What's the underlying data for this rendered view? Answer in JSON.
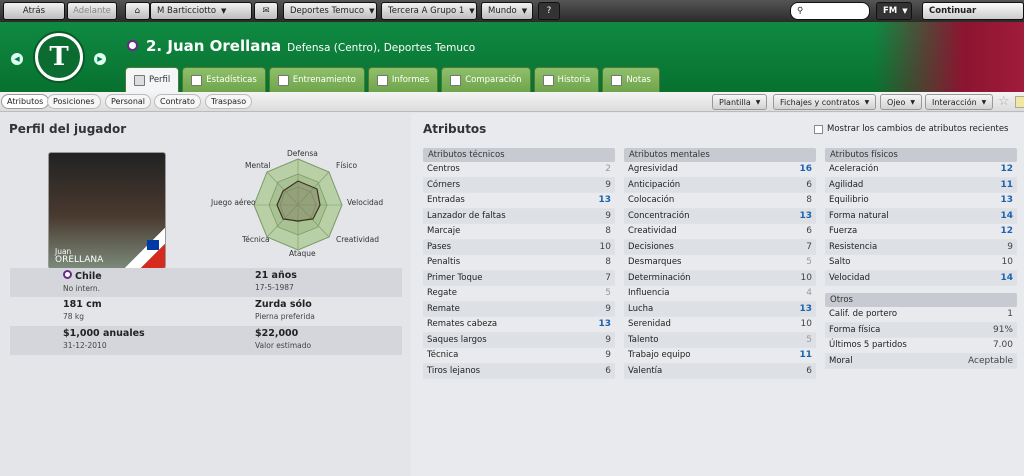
{
  "topbar": {
    "back": "Atrás",
    "forward": "Adelante",
    "manager": "M Barticciotto",
    "club": "Deportes Temuco",
    "league": "Tercera A Grupo 1",
    "world": "Mundo",
    "help": "?",
    "fm": "FM",
    "continue": "Continuar"
  },
  "header": {
    "number_name": "2. Juan Orellana",
    "subtitle": "Defensa (Centro), Deportes Temuco",
    "crest_letter": "T"
  },
  "tabs": [
    "Perfil",
    "Estadísticas",
    "Entrenamiento",
    "Informes",
    "Comparación",
    "Historia",
    "Notas"
  ],
  "subtabs": [
    "Atributos",
    "Posiciones",
    "Personal",
    "Contrato",
    "Traspaso"
  ],
  "actions": [
    "Plantilla",
    "Fichajes y contratos",
    "Ojeo",
    "Interacción"
  ],
  "profile": {
    "title": "Perfil del jugador",
    "photo_first": "Juan",
    "photo_last": "ORELLANA",
    "radar_labels": {
      "top": "Defensa",
      "tr": "Físico",
      "r": "Velocidad",
      "br": "Creatividad",
      "b": "Ataque",
      "bl": "Técnica",
      "l": "Juego aéreo",
      "tl": "Mental"
    },
    "nation": "Chile",
    "intl": "No intern.",
    "age": "21 años",
    "dob": "17-5-1987",
    "height": "181 cm",
    "weight": "78 kg",
    "foot": "Zurda sólo",
    "foot_label": "Pierna preferida",
    "wage": "$1,000 anuales",
    "contract_end": "31-12-2010",
    "value": "$22,000",
    "value_label": "Valor estimado"
  },
  "attributes": {
    "title": "Atributos",
    "checkbox": "Mostrar los cambios de atributos recientes",
    "technical": {
      "title": "Atributos técnicos",
      "rows": [
        [
          "Centros",
          "2"
        ],
        [
          "Córners",
          "9"
        ],
        [
          "Entradas",
          "13"
        ],
        [
          "Lanzador de faltas",
          "9"
        ],
        [
          "Marcaje",
          "8"
        ],
        [
          "Pases",
          "10"
        ],
        [
          "Penaltis",
          "8"
        ],
        [
          "Primer Toque",
          "7"
        ],
        [
          "Regate",
          "5"
        ],
        [
          "Remate",
          "9"
        ],
        [
          "Remates cabeza",
          "13"
        ],
        [
          "Saques largos",
          "9"
        ],
        [
          "Técnica",
          "9"
        ],
        [
          "Tiros lejanos",
          "6"
        ]
      ]
    },
    "mental": {
      "title": "Atributos mentales",
      "rows": [
        [
          "Agresividad",
          "16"
        ],
        [
          "Anticipación",
          "6"
        ],
        [
          "Colocación",
          "8"
        ],
        [
          "Concentración",
          "13"
        ],
        [
          "Creatividad",
          "6"
        ],
        [
          "Decisiones",
          "7"
        ],
        [
          "Desmarques",
          "5"
        ],
        [
          "Determinación",
          "10"
        ],
        [
          "Influencia",
          "4"
        ],
        [
          "Lucha",
          "13"
        ],
        [
          "Serenidad",
          "10"
        ],
        [
          "Talento",
          "5"
        ],
        [
          "Trabajo equipo",
          "11"
        ],
        [
          "Valentía",
          "6"
        ]
      ]
    },
    "physical": {
      "title": "Atributos físicos",
      "rows": [
        [
          "Aceleración",
          "12"
        ],
        [
          "Agilidad",
          "11"
        ],
        [
          "Equilibrio",
          "13"
        ],
        [
          "Forma natural",
          "14"
        ],
        [
          "Fuerza",
          "12"
        ],
        [
          "Resistencia",
          "9"
        ],
        [
          "Salto",
          "10"
        ],
        [
          "Velocidad",
          "14"
        ]
      ]
    },
    "other": {
      "title": "Otros",
      "rows": [
        [
          "Calif. de portero",
          "1"
        ],
        [
          "Forma física",
          "91%"
        ],
        [
          "Últimos 5 partidos",
          "7.00"
        ],
        [
          "Moral",
          "Aceptable"
        ]
      ]
    }
  }
}
